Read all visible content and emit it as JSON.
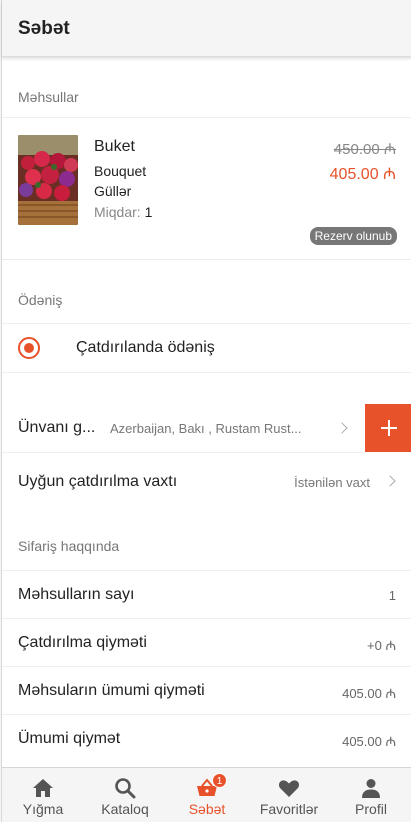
{
  "header": {
    "title": "Səbət"
  },
  "products_section": {
    "title": "Məhsullar"
  },
  "product": {
    "name": "Buket",
    "subtitle": "Bouquet",
    "category": "Güllər",
    "quantity_label": "Miqdar: ",
    "quantity": "1",
    "old_price": "450.00 ₼",
    "new_price": "405.00 ₼",
    "status_badge": "Rezerv olunub"
  },
  "payment_section": {
    "title": "Ödəniş"
  },
  "payment_option": {
    "label": "Çatdırılanda ödəniş",
    "selected": true
  },
  "address": {
    "label": "Ünvanı g...",
    "value": "Azerbaijan, Bakı , Rustam Rust...",
    "add_icon": "plus-icon"
  },
  "delivery_time": {
    "label": "Uyğun çatdırılma vaxtı",
    "value": "İstənilən vaxt"
  },
  "order_section": {
    "title": "Sifariş haqqında"
  },
  "summary": [
    {
      "label": "Məhsulların sayı",
      "value": "1"
    },
    {
      "label": "Çatdırılma qiyməti",
      "value": "+0 ₼"
    },
    {
      "label": "Məhsuların ümumi qiyməti",
      "value": "405.00 ₼"
    },
    {
      "label": "Ümumi qiymət",
      "value": "405.00 ₼"
    }
  ],
  "tabs": [
    {
      "label": "Yığma",
      "icon": "home-icon"
    },
    {
      "label": "Kataloq",
      "icon": "search-icon"
    },
    {
      "label": "Səbət",
      "icon": "basket-icon",
      "badge": "1",
      "active": true
    },
    {
      "label": "Favoritlər",
      "icon": "heart-icon"
    },
    {
      "label": "Profil",
      "icon": "person-icon"
    }
  ],
  "colors": {
    "accent": "#e8522a",
    "badge_gray": "#777777"
  }
}
